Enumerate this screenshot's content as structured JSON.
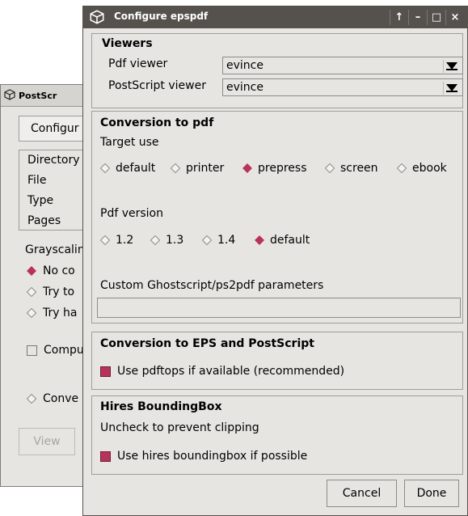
{
  "background_window": {
    "title": "PostScr",
    "button_label": "Configur",
    "list_items": [
      "Directory",
      "File",
      "Type",
      "Pages"
    ],
    "grayscaling_label": "Grayscalin",
    "radios": [
      {
        "label": "No co",
        "selected": true
      },
      {
        "label": "Try to",
        "selected": false
      },
      {
        "label": "Try ha",
        "selected": false
      }
    ],
    "checkbox_label": "Compu",
    "conve_radio_label": "Conve",
    "view_button": "View"
  },
  "dialog": {
    "title": "Configure epspdf",
    "title_buttons": [
      "↑",
      "–",
      "□",
      "×"
    ],
    "viewers": {
      "heading": "Viewers",
      "pdf_viewer_label": "Pdf viewer",
      "pdf_viewer_value": "evince",
      "ps_viewer_label": "PostScript viewer",
      "ps_viewer_value": "evince"
    },
    "conversion_pdf": {
      "heading": "Conversion to pdf",
      "target_use_label": "Target use",
      "target_options": [
        {
          "label": "default",
          "selected": false
        },
        {
          "label": "printer",
          "selected": false
        },
        {
          "label": "prepress",
          "selected": true
        },
        {
          "label": "screen",
          "selected": false
        },
        {
          "label": "ebook",
          "selected": false
        }
      ],
      "pdf_version_label": "Pdf version",
      "version_options": [
        {
          "label": "1.2",
          "selected": false
        },
        {
          "label": "1.3",
          "selected": false
        },
        {
          "label": "1.4",
          "selected": false
        },
        {
          "label": "default",
          "selected": true
        }
      ],
      "custom_params_label": "Custom Ghostscript/ps2pdf parameters",
      "custom_params_value": ""
    },
    "conversion_eps": {
      "heading": "Conversion to EPS and PostScript",
      "pdftops_label": "Use pdftops if available (recommended)",
      "pdftops_checked": true
    },
    "hires": {
      "heading": "Hires BoundingBox",
      "note": "Uncheck to prevent clipping",
      "checkbox_label": "Use hires boundingbox if possible",
      "checked": true
    },
    "buttons": {
      "cancel": "Cancel",
      "done": "Done"
    }
  },
  "colors": {
    "accent": "#b8335a",
    "titlebar": "#55524e",
    "window_bg": "#e7e5e2"
  }
}
